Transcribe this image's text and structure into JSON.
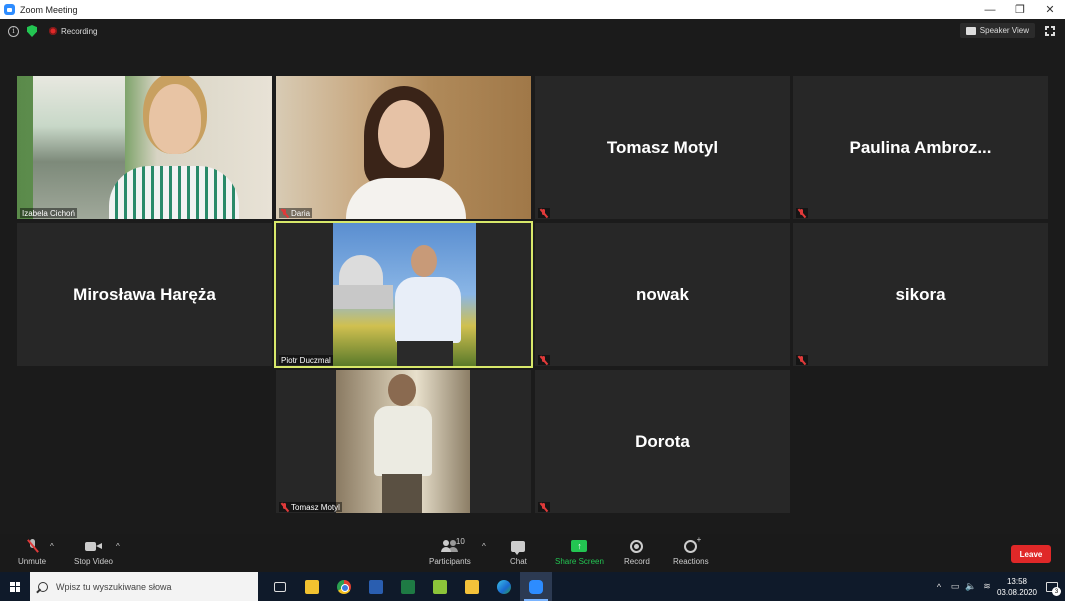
{
  "window": {
    "title": "Zoom Meeting",
    "controls": {
      "minimize": "—",
      "restore": "❐",
      "close": "✕"
    }
  },
  "meeting": {
    "recording_label": "Recording",
    "speaker_view_label": "Speaker View",
    "tiles": [
      {
        "name": "Izabela Cichoń",
        "video": true,
        "muted": false
      },
      {
        "name": "Daria",
        "video": true,
        "muted": true
      },
      {
        "name": "Tomasz Motyl",
        "video": false,
        "muted": true
      },
      {
        "name": "Paulina  Ambroz...",
        "video": false,
        "muted": true
      },
      {
        "name": "Mirosława Haręża",
        "video": false,
        "muted": false
      },
      {
        "name": "Piotr Duczmal",
        "video": true,
        "muted": false,
        "active_speaker": true
      },
      {
        "name": "nowak",
        "video": false,
        "muted": true
      },
      {
        "name": "sikora",
        "video": false,
        "muted": true
      },
      {
        "name": "Tomasz Motyl",
        "video": true,
        "muted": true
      },
      {
        "name": "Dorota",
        "video": false,
        "muted": true
      }
    ]
  },
  "toolbar": {
    "unmute": "Unmute",
    "stop_video": "Stop Video",
    "participants": "Participants",
    "participants_count": "10",
    "chat": "Chat",
    "share_screen": "Share Screen",
    "record": "Record",
    "reactions": "Reactions",
    "leave": "Leave",
    "caret": "^",
    "share_arrow": "↑"
  },
  "taskbar": {
    "search_placeholder": "Wpisz tu wyszukiwane słowa",
    "apps": [
      "task-view",
      "file-explorer",
      "chrome",
      "word",
      "excel",
      "notepad-plus",
      "sticky-notes",
      "edge",
      "zoom"
    ],
    "tray": {
      "chevron": "^",
      "battery": "▭",
      "volume": "🔈",
      "wifi": "≋"
    },
    "time": "13:58",
    "date": "03.08.2020",
    "notification_count": "3"
  },
  "colors": {
    "accent": "#2d8cff",
    "active_speaker_border": "#d8e86a",
    "share_green": "#23c552",
    "leave_red": "#e02828",
    "muted_red": "#e03a3a"
  }
}
